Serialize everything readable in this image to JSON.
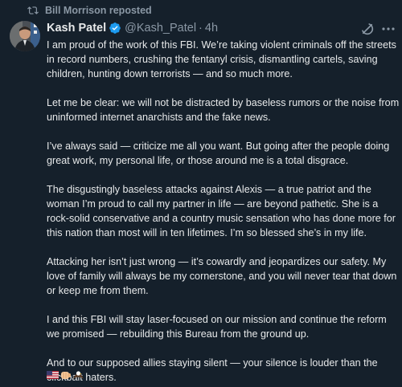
{
  "repost": {
    "text": "Bill Morrison reposted",
    "icon": "repost-icon"
  },
  "author": {
    "name": "Kash Patel",
    "handle": "@Kash_Patel",
    "separator": "·",
    "time": "4h",
    "verified": true,
    "verified_color": "#1d9bf0"
  },
  "actions": {
    "grok_icon": "grok-icon",
    "more_icon": "more-icon"
  },
  "paragraphs": [
    "I am proud of the work of this FBI. We’re taking violent criminals off the streets in record numbers, crushing the fentanyl crisis, dismantling cartels, saving children, hunting down terrorists — and so much more.",
    "Let me be clear: we will not be distracted by baseless rumors or the noise from uninformed internet anarchists and the fake news.",
    "I’ve always said — criticize me all you want. But going after the people doing great work, my personal life, or those around me is a total disgrace.",
    "The disgustingly baseless attacks against Alexis — a true patriot and the woman I’m proud to call my partner in life — are beyond pathetic. She is a rock-solid conservative and a country music sensation who has done more for this nation than most will in ten lifetimes. I’m so blessed she’s in my life.",
    "Attacking her isn’t just wrong — it’s cowardly and jeopardizes our safety. My love of family will always be my cornerstone, and you will never tear that down or keep me from them.",
    "I and this FBI will stay laser-focused on our mission and continue the reform we promised — rebuilding this Bureau from the ground up.",
    "And to our supposed allies staying silent — your silence is louder than the clickbait haters."
  ],
  "emojis": [
    "us-flag-emoji",
    "fist-bump-emoji",
    "eagle-emoji"
  ],
  "colors": {
    "background": "#15202b",
    "text": "#e7e9ea",
    "secondary": "#8b98a5"
  }
}
